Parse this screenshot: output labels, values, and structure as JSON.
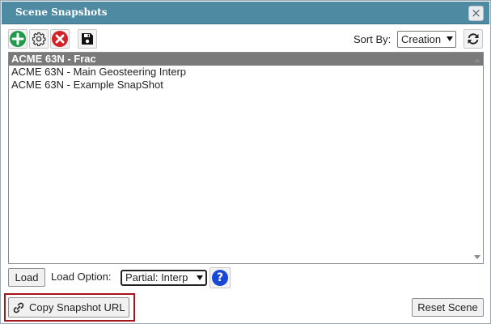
{
  "dialog": {
    "title": "Scene Snapshots",
    "close_symbol": "×"
  },
  "toolbar": {
    "add_icon": "plus-circle-icon",
    "settings_icon": "gear-icon",
    "delete_icon": "x-circle-icon",
    "save_icon": "floppy-disk-icon",
    "colors": {
      "add": "#1f9a4a",
      "delete": "#d2232a"
    }
  },
  "sort": {
    "label": "Sort By:",
    "selected": "Creation",
    "refresh_icon": "refresh-icon"
  },
  "snapshots": {
    "items": [
      "ACME 63N - Frac",
      "ACME 63N - Main Geosteering Interp",
      "ACME 63N - Example SnapShot"
    ],
    "selected_index": 0
  },
  "load": {
    "button_label": "Load",
    "option_label": "Load Option:",
    "option_selected": "Partial: Interp",
    "help_symbol": "?"
  },
  "footer": {
    "copy_url_label": "Copy Snapshot URL",
    "copy_url_icon": "link-icon",
    "reset_label": "Reset Scene",
    "highlight_color": "#a3141c"
  }
}
